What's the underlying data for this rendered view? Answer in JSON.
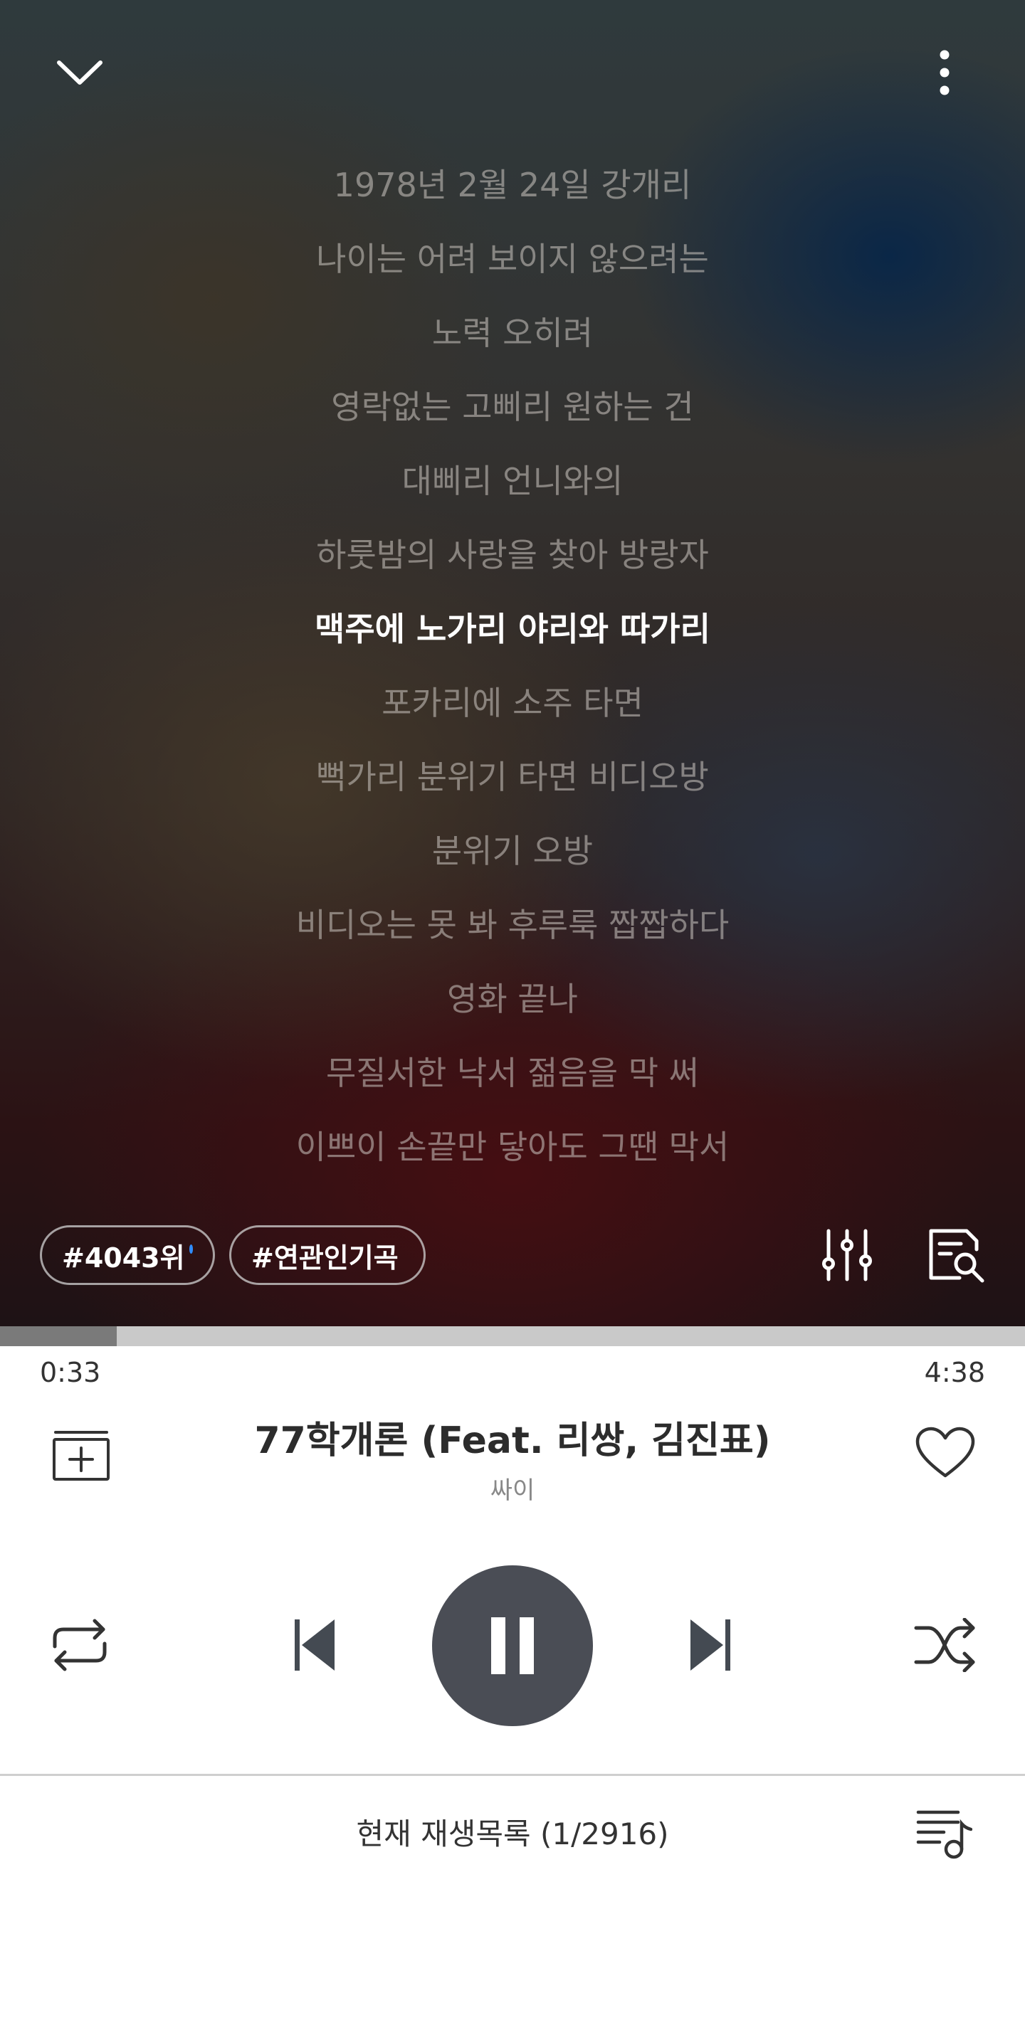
{
  "lyrics": [
    "1978년 2월 24일 강개리",
    "나이는 어려 보이지 않으려는",
    "노력 오히려",
    "영락없는 고삐리 원하는 건",
    "대삐리 언니와의",
    "하룻밤의 사랑을 찾아 방랑자",
    "맥주에 노가리 야리와 따가리",
    "포카리에 소주 타면",
    "뻑가리 분위기 타면 비디오방",
    "분위기 오방",
    "비디오는 못 봐 후루룩 짭짭하다",
    "영화 끝나",
    "무질서한 낙서 젊음을 막 써",
    "이쁘이 손끝만 닿아도 그땐 막서"
  ],
  "active_lyric_index": 6,
  "tags": {
    "rank": "#4043위",
    "related": "#연관인기곡"
  },
  "progress": {
    "current": "0:33",
    "total": "4:38",
    "fraction": 0.114
  },
  "song": {
    "title": "77학개론 (Feat. 리쌍, 김진표)",
    "artist": "싸이"
  },
  "playlist": {
    "label": "현재 재생목록 (1/2916)"
  },
  "colors": {
    "play_button": "#4a4d55",
    "tag_dot": "#2f8cff",
    "active_lyric": "#ffffff"
  },
  "icons": {
    "collapse": "chevron-down-icon",
    "more": "more-vertical-icon",
    "equalizer": "equalizer-icon",
    "lyrics_search": "lyrics-search-icon",
    "add": "add-to-playlist-icon",
    "like": "heart-icon",
    "repeat": "repeat-icon",
    "previous": "skip-previous-icon",
    "pause": "pause-icon",
    "next": "skip-next-icon",
    "shuffle": "shuffle-icon",
    "queue": "queue-music-icon"
  }
}
